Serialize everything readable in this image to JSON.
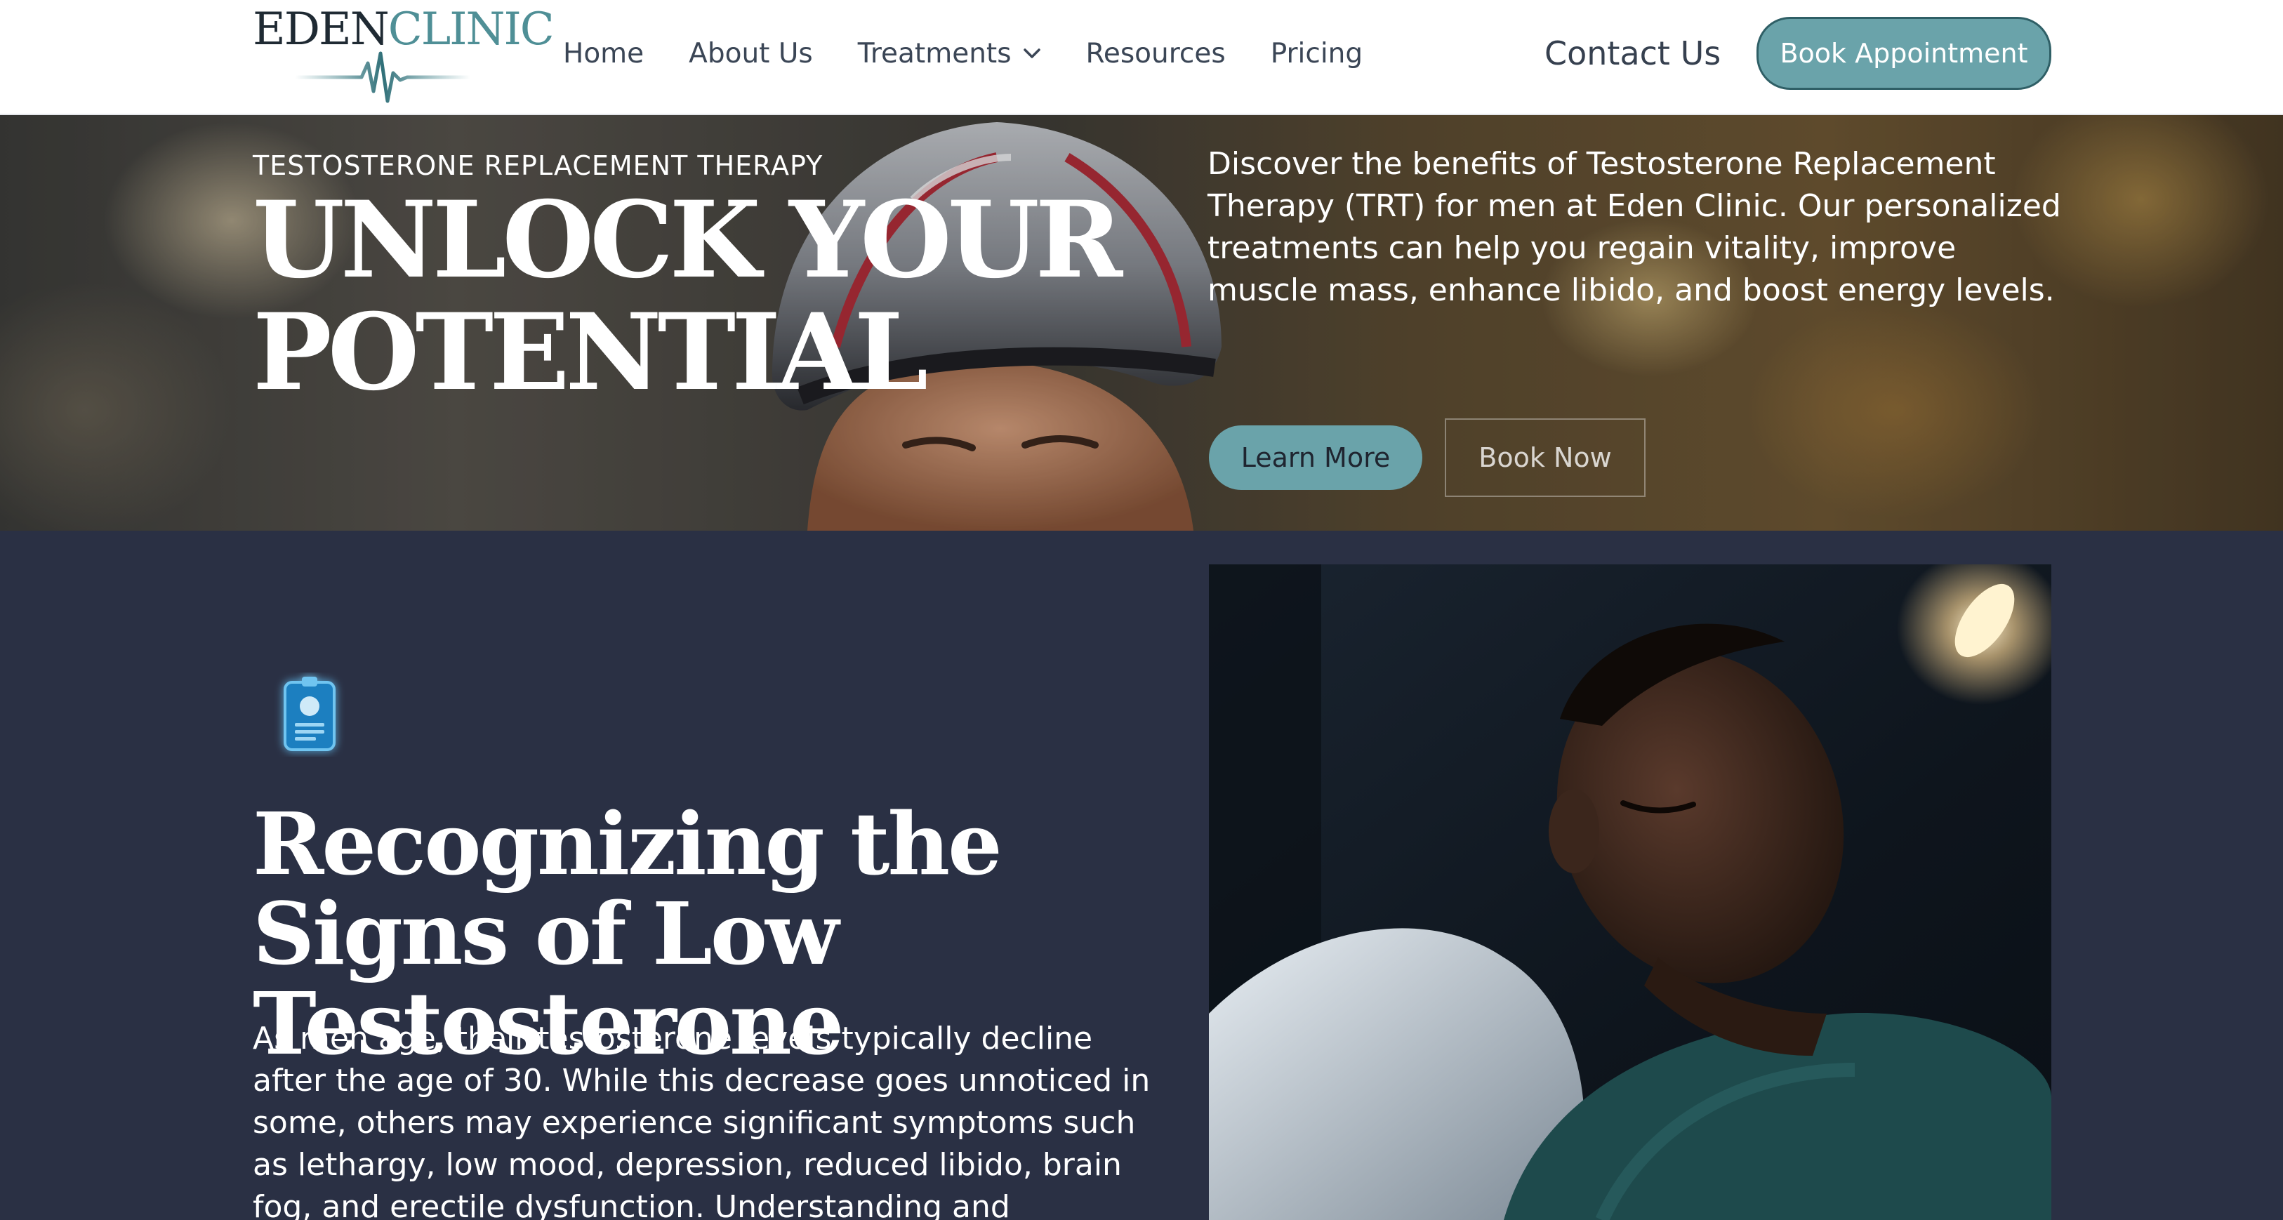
{
  "nav": {
    "logo": {
      "part1": "EDEN",
      "part2": "CLINIC"
    },
    "links": [
      {
        "label": "Home"
      },
      {
        "label": "About Us"
      },
      {
        "label": "Treatments",
        "has_dropdown": true
      },
      {
        "label": "Resources"
      },
      {
        "label": "Pricing"
      }
    ],
    "contact_label": "Contact Us",
    "book_label": "Book Appointment"
  },
  "hero": {
    "eyebrow": "TESTOSTERONE REPLACEMENT THERAPY",
    "title": "UNLOCK YOUR POTENTIAL",
    "description": "Discover the benefits of Testosterone Replacement Therapy (TRT) for men at Eden Clinic. Our personalized treatments can help you regain vitality, improve muscle mass, enhance libido, and boost energy levels.",
    "primary_button": "Learn More",
    "secondary_button": "Book Now"
  },
  "signs": {
    "icon": "clipboard-icon",
    "title": "Recognizing the Signs of Low Testosterone",
    "body": "As men age, their testosterone levels typically decline after the age of 30. While this decrease goes unnoticed in some, others may experience significant symptoms such as lethargy, low mood, depression, reduced libido, brain fog, and erectile dysfunction. Understanding and"
  },
  "colors": {
    "accent": "#6aa3aa",
    "accent_border": "#2f5f66",
    "section_bg": "#2a3044",
    "nav_text": "#3b4656"
  }
}
